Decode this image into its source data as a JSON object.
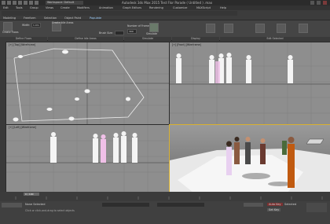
{
  "window": {
    "title": "Autodesk 3ds Max 2015   Test Flor Parade   ( Untitled ) .max",
    "workspace": "Workspace: Default"
  },
  "menu": [
    "Edit",
    "Tools",
    "Group",
    "Views",
    "Create",
    "Modifiers",
    "Animation",
    "Graph Editors",
    "Rendering",
    "Customize",
    "MAXScript",
    "Help"
  ],
  "ribbon_tabs": [
    {
      "label": "Modeling",
      "active": false
    },
    {
      "label": "Freeform",
      "active": false
    },
    {
      "label": "Selection",
      "active": false
    },
    {
      "label": "Object Paint",
      "active": false
    },
    {
      "label": "Populate",
      "active": true
    }
  ],
  "ribbon": {
    "create_flows": "Create Flows",
    "width_label": "Width:",
    "width_value": "1.0m",
    "create_idle_areas": "Create Idle Areas",
    "brush_size": "Brush Size:",
    "number_of_frames": "Number of Frames",
    "simulate": "Simulate",
    "edit_selected": "Edit Selected",
    "groups": [
      "Define Flows",
      "Define Idle Areas",
      "Simulate",
      "Display",
      "Edit Selected"
    ],
    "frames_value": "300"
  },
  "viewports": {
    "top": "[+] [Top] [Wireframe]",
    "front": "[+] [Front] [Wireframe]",
    "left": "[+] [Left] [Wireframe]",
    "perspective": "[+] [Perspective] [Realistic]"
  },
  "timeline": {
    "frame_counter": "0 / 100",
    "ticks": [
      "0",
      "10",
      "20",
      "30",
      "40",
      "50",
      "60",
      "70",
      "80",
      "90",
      "100"
    ]
  },
  "status": {
    "selection": "None Selected",
    "prompt": "Click or click-and-drag to select objects",
    "autokey": "Auto Key",
    "setkey": "Set Key",
    "selected": "Selected"
  },
  "colors": {
    "viewport_bg": "#8e8e8e",
    "active_border": "#d8b030",
    "accent": "#9fd0ff"
  }
}
